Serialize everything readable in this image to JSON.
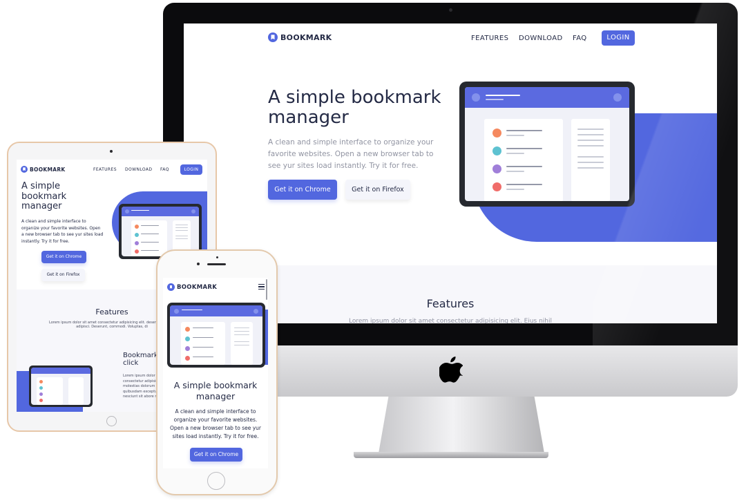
{
  "brand": {
    "name": "BOOKMARK",
    "accent": "#5267df",
    "dark": "#242a45",
    "muted": "#9194a2"
  },
  "nav": {
    "features": "FEATURES",
    "download": "DOWNLOAD",
    "faq": "FAQ",
    "login": "LOGIN"
  },
  "hero": {
    "title": "A simple bookmark manager",
    "text": "A clean and simple interface to organize your favorite websites. Open a new browser tab to see yur sites load instantly. Try it for free.",
    "chrome_button": "Get it on Chrome",
    "firefox_button": "Get it on Firefox"
  },
  "features": {
    "title": "Features",
    "text_desktop": "Lorem ipsum dolor sit amet consectetur adipisicing elit. Eius nihil",
    "text_tablet": "Lorem ipsum dolor sit amet consectetur adipisicing elit. deserunt, quo in adipisci. Deserunt, commodi. Voluptas, di",
    "tab_heading": "Bookmark in one click",
    "tab_text": "Lorem ipsum dolor sit amet consectetur adipisicing elit. molestias dolorum distinctio sunt, quibusdam excepturi natus nesciunt sit abore mollitia dolore"
  },
  "icons": {
    "apple": "apple-logo-icon",
    "menu": "hamburger-menu-icon",
    "logo": "bookmark-logo-icon"
  },
  "illustration_colors": {
    "orange": "#f5895f",
    "teal": "#5ec2d1",
    "purple": "#a07fd9",
    "red": "#f06d6a"
  }
}
